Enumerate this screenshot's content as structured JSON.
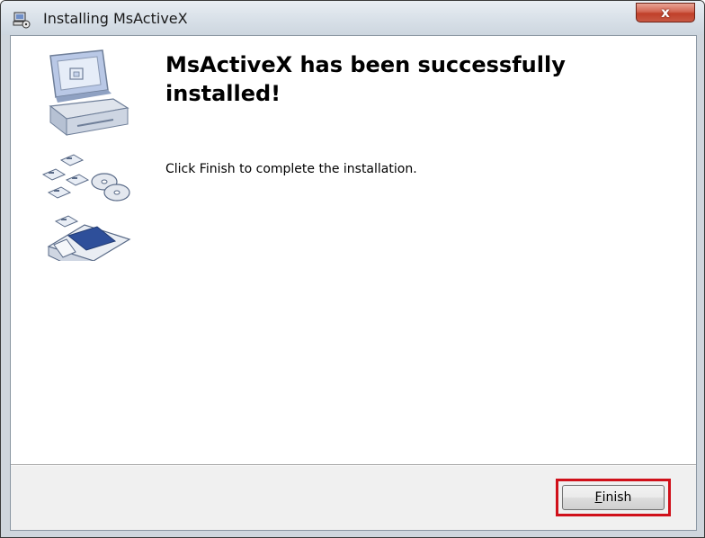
{
  "window": {
    "title": "Installing MsActiveX",
    "close_label": "x"
  },
  "main": {
    "headline": "MsActiveX has been successfully installed!",
    "message": "Click Finish to complete the installation."
  },
  "footer": {
    "finish_mnemonic": "F",
    "finish_rest": "inish"
  },
  "icons": {
    "title": "setup-icon",
    "art": "computer-disks-installer-illustration",
    "close": "close-icon"
  },
  "colors": {
    "highlight": "#d0101a",
    "close_button": "#c0402a"
  }
}
